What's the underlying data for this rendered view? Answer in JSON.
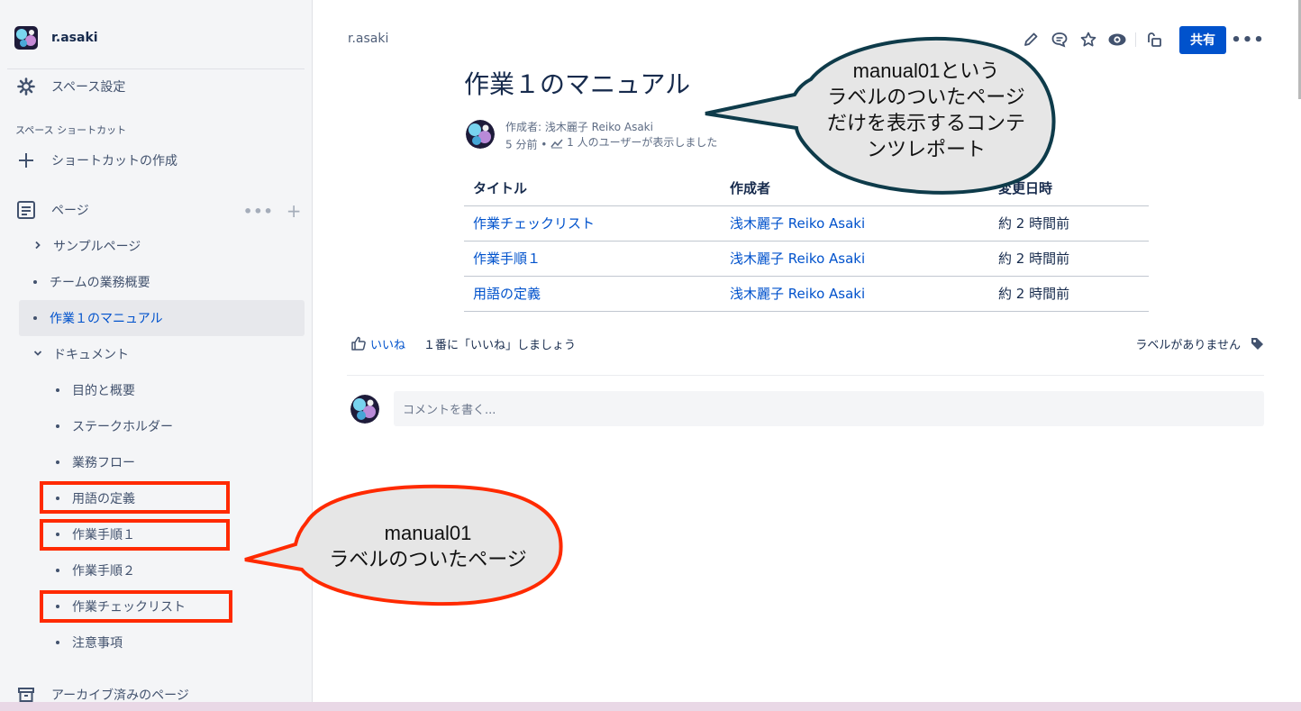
{
  "sidebar": {
    "space_name": "r.asaki",
    "settings_label": "スペース設定",
    "shortcuts_heading": "スペース ショートカット",
    "create_shortcut_label": "ショートカットの作成",
    "pages_label": "ページ",
    "archived_label": "アーカイブ済みのページ",
    "tree": [
      {
        "label": "サンプルページ",
        "marker": "chevron-right"
      },
      {
        "label": "チームの業務概要",
        "marker": "bullet"
      },
      {
        "label": "作業１のマニュアル",
        "marker": "bullet",
        "active": true
      },
      {
        "label": "ドキュメント",
        "marker": "chevron-down"
      },
      {
        "label": "目的と概要",
        "marker": "bullet"
      },
      {
        "label": "ステークホルダー",
        "marker": "bullet"
      },
      {
        "label": "業務フロー",
        "marker": "bullet"
      },
      {
        "label": "用語の定義",
        "marker": "bullet",
        "highlighted": true
      },
      {
        "label": "作業手順１",
        "marker": "bullet",
        "highlighted": true
      },
      {
        "label": "作業手順２",
        "marker": "bullet"
      },
      {
        "label": "作業チェックリスト",
        "marker": "bullet",
        "highlighted": true
      },
      {
        "label": "注意事項",
        "marker": "bullet"
      }
    ]
  },
  "header": {
    "breadcrumb": "r.asaki",
    "share_label": "共有",
    "icons": [
      "edit-icon",
      "comment-icon",
      "star-icon",
      "watch-icon",
      "restrictions-icon",
      "more-icon"
    ]
  },
  "page": {
    "title": "作業１のマニュアル",
    "author_line": "作成者: 浅木麗子 Reiko Asaki",
    "time_ago": "5 分前 •",
    "views": "1 人のユーザーが表示しました"
  },
  "report_table": {
    "headers": [
      "タイトル",
      "作成者",
      "変更日時"
    ],
    "rows": [
      [
        "作業チェックリスト",
        "浅木麗子 Reiko Asaki",
        "約 2 時間前"
      ],
      [
        "作業手順１",
        "浅木麗子 Reiko Asaki",
        "約 2 時間前"
      ],
      [
        "用語の定義",
        "浅木麗子 Reiko Asaki",
        "約 2 時間前"
      ]
    ]
  },
  "reactions": {
    "like_label": "いいね",
    "like_message": "１番に「いいね」しましょう",
    "labels_text": "ラベルがありません"
  },
  "comment": {
    "placeholder": "コメントを書く..."
  },
  "callouts": {
    "top_text": "manual01という\nラベルのついたページ\nだけを表示するコンテ\nンツレポート",
    "bottom_text": "manual01\nラベルのついたページ"
  },
  "colors": {
    "primary": "#0052cc",
    "highlight_box": "#ff2a00",
    "top_callout_border": "#0e3b4a",
    "bottom_callout_border": "#ff2a00",
    "callout_fill": "#e6e6e6"
  }
}
